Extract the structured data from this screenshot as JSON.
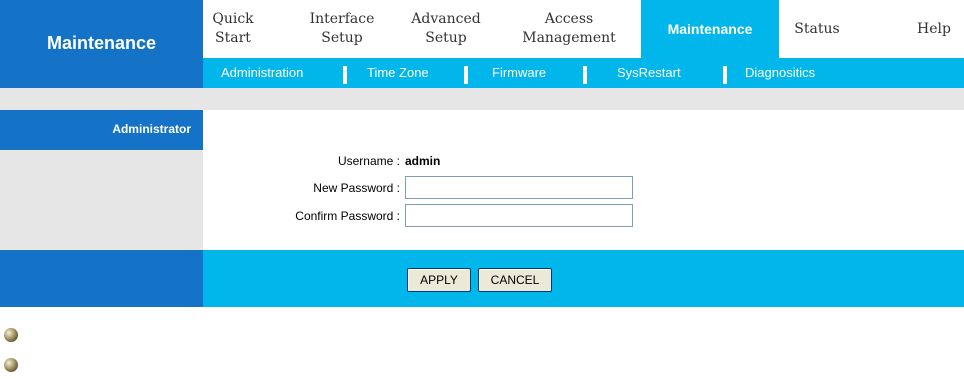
{
  "brand": {
    "label": "Maintenance"
  },
  "nav": {
    "quick_start": [
      "Quick",
      "Start"
    ],
    "interface_setup": [
      "Interface",
      "Setup"
    ],
    "advanced_setup": [
      "Advanced",
      "Setup"
    ],
    "access_management": [
      "Access",
      "Management"
    ],
    "maintenance": "Maintenance",
    "status": "Status",
    "help": "Help"
  },
  "subnav": {
    "administration": "Administration",
    "time_zone": "Time Zone",
    "firmware": "Firmware",
    "sysrestart": "SysRestart",
    "diagnostics": "Diagnositics"
  },
  "section": {
    "title": "Administrator"
  },
  "form": {
    "username_label": "Username :",
    "username_value": "admin",
    "new_password_label": "New Password :",
    "confirm_password_label": "Confirm Password :",
    "new_password_value": "",
    "confirm_password_value": ""
  },
  "buttons": {
    "apply": "APPLY",
    "cancel": "CANCEL"
  },
  "colors": {
    "brand_blue": "#1473c6",
    "accent_cyan": "#00b6eb",
    "panel_gray": "#e6e6e6"
  }
}
